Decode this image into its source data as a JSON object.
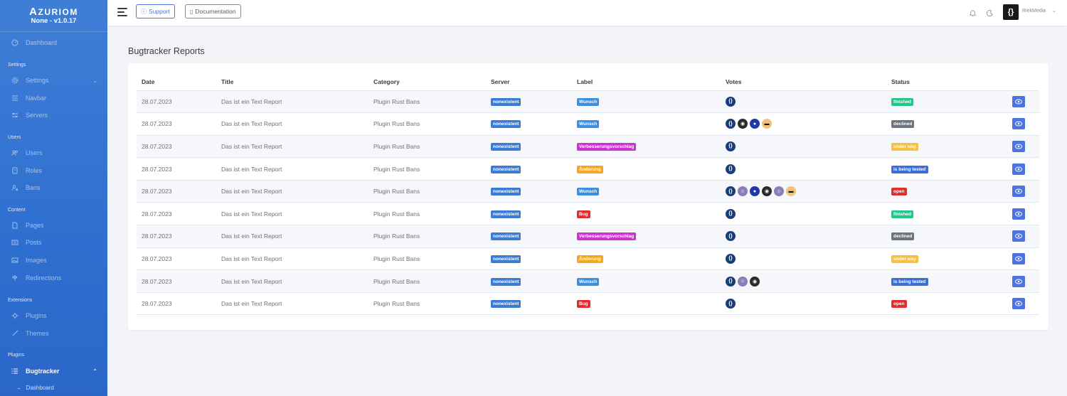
{
  "brand": {
    "logo_initial": "A",
    "logo_rest": "ZURIOM",
    "version": "None - v1.0.17"
  },
  "sidebar": {
    "dashboard": "Dashboard",
    "settings_header": "Settings",
    "settings": "Settings",
    "navbar": "Navbar",
    "servers": "Servers",
    "users_header": "Users",
    "users": "Users",
    "roles": "Roles",
    "bans": "Bans",
    "content_header": "Content",
    "pages": "Pages",
    "posts": "Posts",
    "images": "Images",
    "redirections": "Redirections",
    "extensions_header": "Extensions",
    "plugins": "Plugins",
    "themes": "Themes",
    "plugins_header": "Plugins",
    "bugtracker": "Bugtracker",
    "bugtracker_dashboard": "Dashboard"
  },
  "topbar": {
    "support": "Support",
    "documentation": "Documentation",
    "user_name": "RiekMedia",
    "avatar_text": "{}"
  },
  "page": {
    "title": "Bugtracker Reports"
  },
  "table": {
    "headers": {
      "date": "Date",
      "title": "Title",
      "category": "Category",
      "server": "Server",
      "label": "Label",
      "votes": "Votes",
      "status": "Status"
    },
    "rows": [
      {
        "date": "28.07.2023",
        "title": "Das ist ein Text Report",
        "category": "Plugin Rust Bans",
        "server": "nonexistent",
        "label": "Wunsch",
        "label_color": "#3a8fe0",
        "votes": [
          "brace"
        ],
        "status": "finished",
        "status_color": "#1cc88a"
      },
      {
        "date": "28.07.2023",
        "title": "Das ist ein Text Report",
        "category": "Plugin Rust Bans",
        "server": "nonexistent",
        "label": "Wunsch",
        "label_color": "#3a8fe0",
        "votes": [
          "brace",
          "gorilla",
          "earth",
          "shades"
        ],
        "status": "declined",
        "status_color": "#6c757d"
      },
      {
        "date": "28.07.2023",
        "title": "Das ist ein Text Report",
        "category": "Plugin Rust Bans",
        "server": "nonexistent",
        "label": "Verbesserungsvorschlag",
        "label_color": "#d12fd6",
        "votes": [
          "brace"
        ],
        "status": "under way",
        "status_color": "#f6c23e"
      },
      {
        "date": "28.07.2023",
        "title": "Das ist ein Text Report",
        "category": "Plugin Rust Bans",
        "server": "nonexistent",
        "label": "Änderung",
        "label_color": "#f5a623",
        "votes": [
          "brace"
        ],
        "status": "is being tested",
        "status_color": "#3a6fd8"
      },
      {
        "date": "28.07.2023",
        "title": "Das ist ein Text Report",
        "category": "Plugin Rust Bans",
        "server": "nonexistent",
        "label": "Wunsch",
        "label_color": "#3a8fe0",
        "votes": [
          "brace",
          "anime",
          "earth",
          "gorilla",
          "anime",
          "shades"
        ],
        "status": "open",
        "status_color": "#e02d2d"
      },
      {
        "date": "28.07.2023",
        "title": "Das ist ein Text Report",
        "category": "Plugin Rust Bans",
        "server": "nonexistent",
        "label": "Bug",
        "label_color": "#e02d2d",
        "votes": [
          "brace"
        ],
        "status": "finished",
        "status_color": "#1cc88a"
      },
      {
        "date": "28.07.2023",
        "title": "Das ist ein Text Report",
        "category": "Plugin Rust Bans",
        "server": "nonexistent",
        "label": "Verbesserungsvorschlag",
        "label_color": "#d12fd6",
        "votes": [
          "brace"
        ],
        "status": "declined",
        "status_color": "#6c757d"
      },
      {
        "date": "28.07.2023",
        "title": "Das ist ein Text Report",
        "category": "Plugin Rust Bans",
        "server": "nonexistent",
        "label": "Änderung",
        "label_color": "#f5a623",
        "votes": [
          "brace"
        ],
        "status": "under way",
        "status_color": "#f6c23e"
      },
      {
        "date": "28.07.2023",
        "title": "Das ist ein Text Report",
        "category": "Plugin Rust Bans",
        "server": "nonexistent",
        "label": "Wunsch",
        "label_color": "#3a8fe0",
        "votes": [
          "brace",
          "anime",
          "gorilla"
        ],
        "status": "is being tested",
        "status_color": "#3a6fd8"
      },
      {
        "date": "28.07.2023",
        "title": "Das ist ein Text Report",
        "category": "Plugin Rust Bans",
        "server": "nonexistent",
        "label": "Bug",
        "label_color": "#e02d2d",
        "votes": [
          "brace"
        ],
        "status": "open",
        "status_color": "#e02d2d"
      }
    ]
  },
  "colors": {
    "accent": "#4e73df",
    "server_badge": "#3a7bd5",
    "sidebar": "#2f6fd0"
  }
}
